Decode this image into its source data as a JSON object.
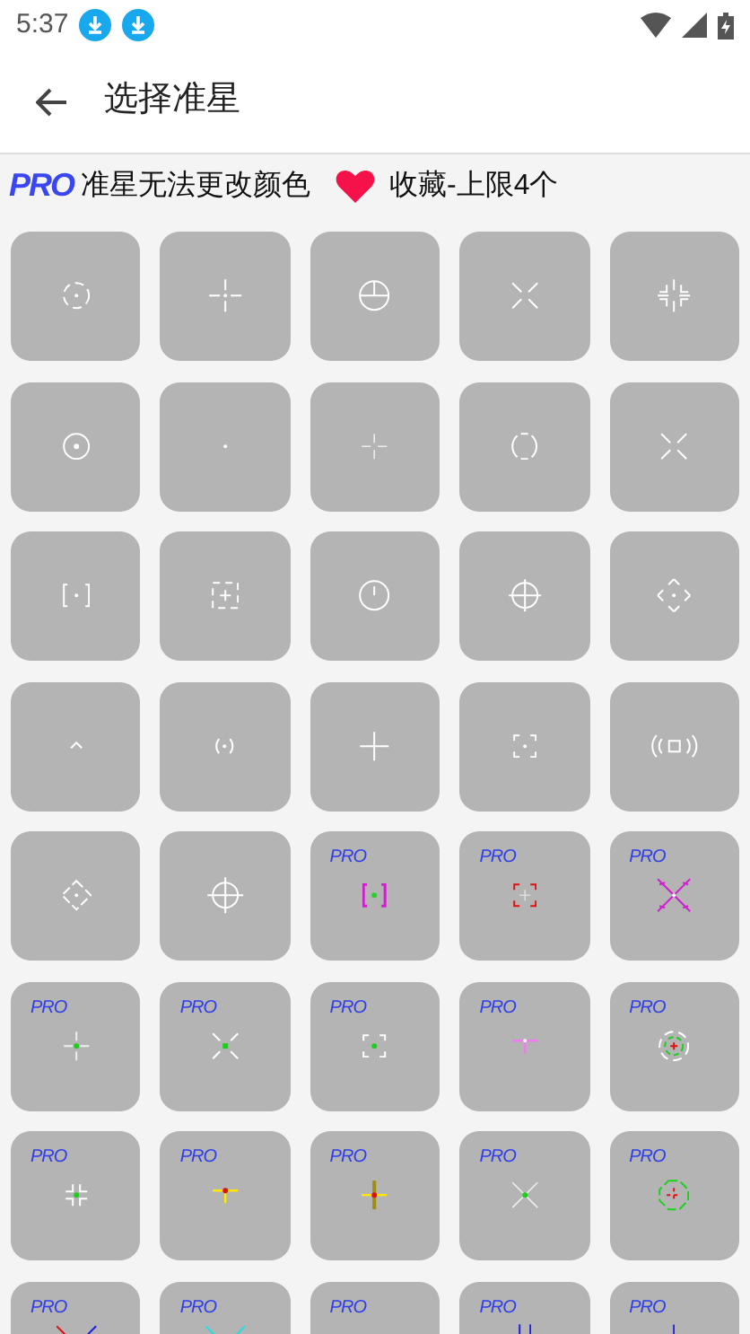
{
  "status_bar": {
    "time": "5:37"
  },
  "app_bar": {
    "title": "选择准星"
  },
  "notice": {
    "pro_badge": "PRO",
    "pro_text": "准星无法更改颜色",
    "favorite_text": "收藏-上限4个"
  },
  "tiles": [
    {
      "kind": "dashed-ring"
    },
    {
      "kind": "gap-cross"
    },
    {
      "kind": "circle-cross"
    },
    {
      "kind": "gap-x"
    },
    {
      "kind": "corner-cross"
    },
    {
      "kind": "ring-dot"
    },
    {
      "kind": "dot"
    },
    {
      "kind": "thin-cross"
    },
    {
      "kind": "bracket-ring"
    },
    {
      "kind": "gap-x"
    },
    {
      "kind": "square-brackets"
    },
    {
      "kind": "dashed-square"
    },
    {
      "kind": "circle-tick"
    },
    {
      "kind": "circle-crosshair"
    },
    {
      "kind": "diamond-arrows"
    },
    {
      "kind": "chevron"
    },
    {
      "kind": "paren-dot"
    },
    {
      "kind": "plus"
    },
    {
      "kind": "square-corners"
    },
    {
      "kind": "radar"
    },
    {
      "kind": "diamond-ring"
    },
    {
      "kind": "scope"
    },
    {
      "kind": "pro-brackets",
      "badge": "PRO"
    },
    {
      "kind": "pro-corners",
      "badge": "PRO"
    },
    {
      "kind": "pro-x-arrows",
      "badge": "PRO"
    },
    {
      "kind": "pro-cross-dot",
      "badge": "PRO"
    },
    {
      "kind": "pro-diag-square",
      "badge": "PRO"
    },
    {
      "kind": "pro-corners-dot",
      "badge": "PRO"
    },
    {
      "kind": "pro-t",
      "badge": "PRO"
    },
    {
      "kind": "pro-ring",
      "badge": "PRO"
    },
    {
      "kind": "pro-blocks",
      "badge": "PRO"
    },
    {
      "kind": "pro-t-yellow",
      "badge": "PRO"
    },
    {
      "kind": "pro-cross-yellow",
      "badge": "PRO"
    },
    {
      "kind": "pro-x-dot",
      "badge": "PRO"
    },
    {
      "kind": "pro-octagon",
      "badge": "PRO"
    },
    {
      "kind": "pro-x-red",
      "badge": "PRO"
    },
    {
      "kind": "pro-x-cyan",
      "badge": "PRO"
    },
    {
      "kind": "pro-blank",
      "badge": "PRO"
    },
    {
      "kind": "pro-bars",
      "badge": "PRO"
    },
    {
      "kind": "pro-tick",
      "badge": "PRO"
    }
  ]
}
